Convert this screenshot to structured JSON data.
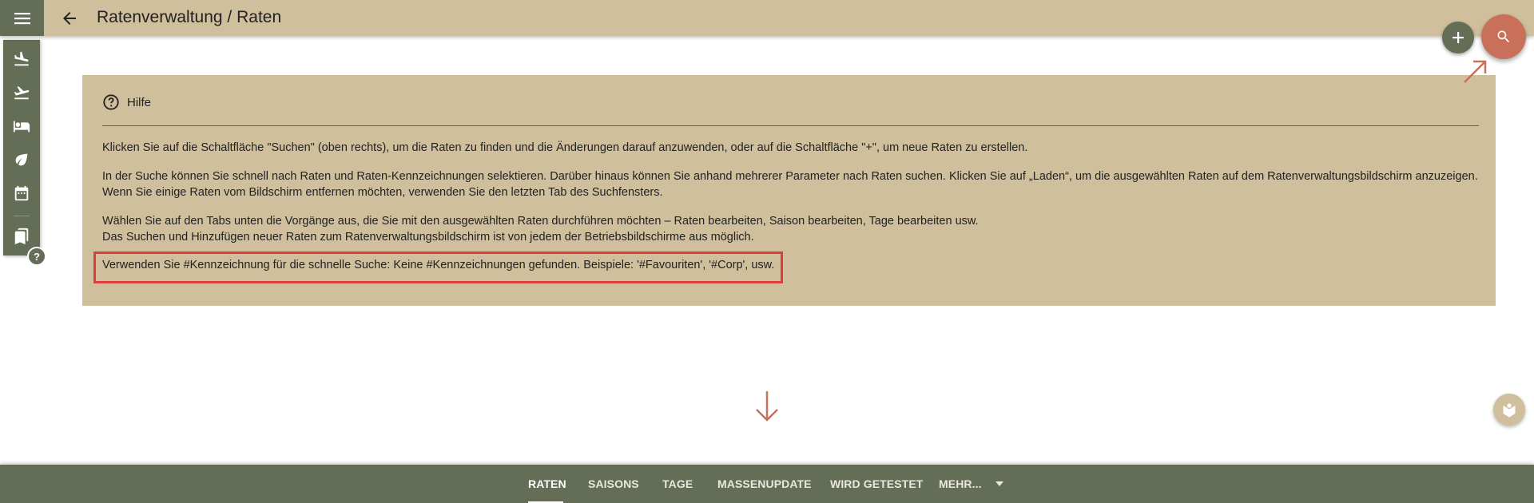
{
  "header": {
    "title": "Ratenverwaltung / Raten",
    "menu_icon": "menu-icon",
    "back_icon": "arrow-back-icon"
  },
  "rail": {
    "items": [
      {
        "icon": "flight-land-icon"
      },
      {
        "icon": "flight-takeoff-icon"
      },
      {
        "icon": "hotel-bed-icon"
      },
      {
        "icon": "leaf-icon"
      },
      {
        "icon": "calendar-icon"
      },
      {
        "icon": "bookmarks-icon"
      }
    ],
    "help_label": "?"
  },
  "fabs": {
    "add_icon": "plus-icon",
    "search_icon": "search-icon"
  },
  "help": {
    "heading": "Hilfe",
    "p1": "Klicken Sie auf die Schaltfläche \"Suchen\" (oben rechts), um die Raten zu finden und die Änderungen darauf anzuwenden, oder auf die Schaltfläche \"+\", um neue Raten zu erstellen.",
    "p2a": "In der Suche können Sie schnell nach Raten und Raten-Kennzeichnungen selektieren. Darüber hinaus können Sie anhand mehrerer Parameter nach Raten suchen. Klicken Sie auf „Laden“, um die ausgewählten Raten auf dem Ratenverwaltungsbildschirm anzuzeigen.",
    "p2b": "Wenn Sie einige Raten vom Bildschirm entfernen möchten, verwenden Sie den letzten Tab des Suchfensters.",
    "p3a": "Wählen Sie auf den Tabs unten die Vorgänge aus, die Sie mit den ausgewählten Raten durchführen möchten – Raten bearbeiten, Saison bearbeiten, Tage bearbeiten usw.",
    "p3b": "Das Suchen und Hinzufügen neuer Raten zum Ratenverwaltungsbildschirm ist von jedem der Betriebsbildschirme aus möglich.",
    "p4": "Verwenden Sie #Kennzeichnung für die schnelle Suche: Keine #Kennzeichnungen gefunden. Beispiele: '#Favouriten', '#Corp', usw."
  },
  "tabs": [
    {
      "label": "RATEN",
      "active": true
    },
    {
      "label": "SAISONS",
      "active": false
    },
    {
      "label": "TAGE",
      "active": false
    },
    {
      "label": "MASSENUPDATE",
      "active": false
    },
    {
      "label": "WIRD GETESTET",
      "active": false
    },
    {
      "label": "MEHR...",
      "active": false
    }
  ],
  "colors": {
    "accent": "#c8705a",
    "primary": "#646d55",
    "panel": "#cfbf9c",
    "highlight_border": "#e03c3c"
  }
}
